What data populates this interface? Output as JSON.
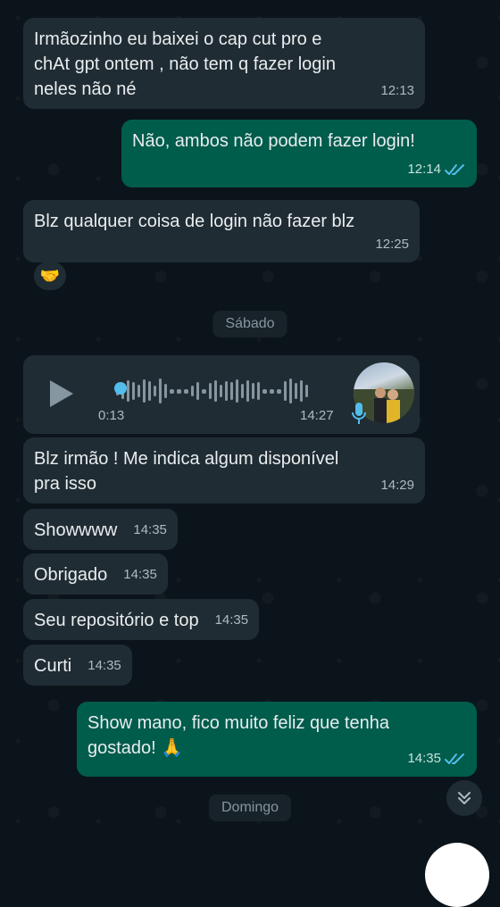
{
  "messages": [
    {
      "text": "Irmãozinho eu baixei o cap cut pro e\nchAt gpt ontem , não tem q fazer login\nneles não né",
      "time": "12:13"
    },
    {
      "text": "Não, ambos não podem fazer login!",
      "time": "12:14"
    },
    {
      "text": "Blz qualquer coisa de login não fazer blz",
      "time": "12:25"
    },
    {
      "text": "Blz irmão ! Me indica algum disponível\npra isso",
      "time": "14:29"
    },
    {
      "text": "Showwww",
      "time": "14:35"
    },
    {
      "text": "Obrigado",
      "time": "14:35"
    },
    {
      "text": "Seu repositório e top",
      "time": "14:35"
    },
    {
      "text": "Curti",
      "time": "14:35"
    },
    {
      "text": "Show mano, fico muito feliz que tenha\ngostado! 🙏",
      "time": "14:35"
    }
  ],
  "reaction": {
    "emoji": "🤝"
  },
  "date_separators": {
    "saturday": "Sábado",
    "sunday": "Domingo"
  },
  "voice_message": {
    "duration": "0:13",
    "time": "14:27",
    "progress": 0
  },
  "icons": {
    "read_receipt": "double-check-icon",
    "play": "play-icon",
    "mic": "microphone-icon",
    "scroll_down": "double-chevron-down-icon"
  },
  "colors": {
    "incoming_bubble": "#202c33",
    "outgoing_bubble": "#005c4b",
    "read_tick": "#53bdeb",
    "background": "#0b141a"
  }
}
